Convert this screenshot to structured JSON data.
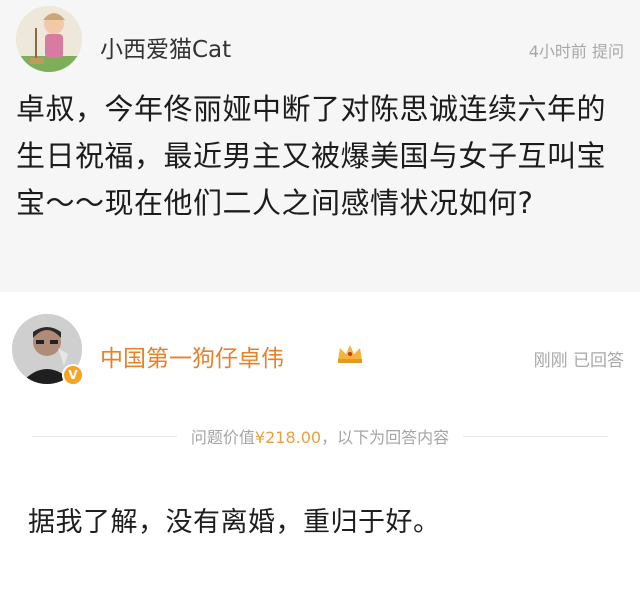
{
  "question": {
    "user_name": "小西爱猫Cat",
    "time": "4小时前",
    "action": "提问",
    "text": "卓叔，今年佟丽娅中断了对陈思诚连续六年的生日祝福，最近男主又被爆美国与女子互叫宝宝～～现在他们二人之间感情状况如何?"
  },
  "answer": {
    "user_name": "中国第一狗仔卓伟",
    "badge_text": "V",
    "time": "刚刚",
    "status": "已回答",
    "price_prefix": "问题价值",
    "price_value": "¥218.00",
    "price_suffix": "，以下为回答内容",
    "text": "据我了解，没有离婚，重归于好。"
  },
  "colors": {
    "question_bg": "#f6f6f6",
    "answerer_name": "#e8812a",
    "meta_gray": "#a8a8a8",
    "verified_badge": "#f7a323",
    "price_value": "#e8a043"
  },
  "icons": {
    "questioner_avatar": "cartoon-avatar-icon",
    "answerer_avatar": "profile-photo-icon",
    "verified": "verified-v-icon",
    "member_crown": "crown-icon"
  }
}
